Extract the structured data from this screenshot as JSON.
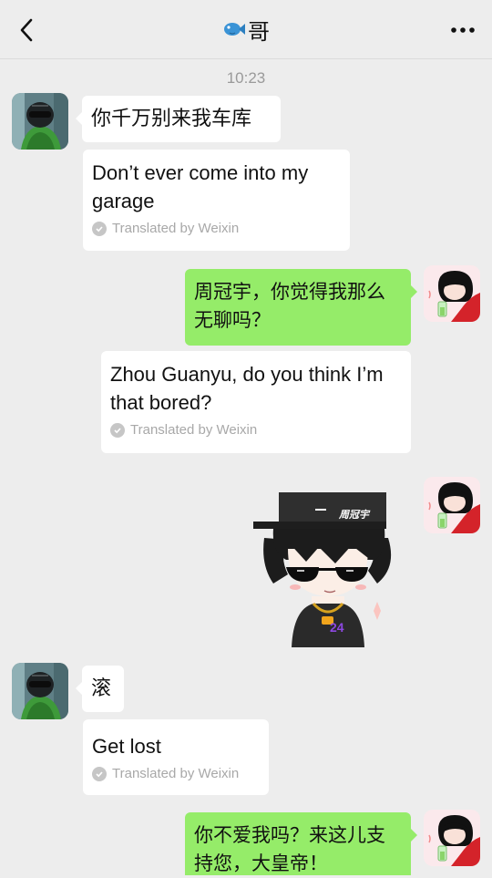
{
  "header": {
    "title_emoji_icon": "fish-icon",
    "title": "哥",
    "back_icon": "chevron-left-icon",
    "more_icon": "ellipsis-icon"
  },
  "timestamp": "10:23",
  "messages": [
    {
      "side": "left",
      "text": "你千万别来我车库",
      "translation": "Don’t ever come into my garage",
      "translated_by": "Translated by Weixin"
    },
    {
      "side": "right",
      "text": "周冠宇，你觉得我那么无聊吗？",
      "translation": "Zhou Guanyu, do you think I’m that bored?",
      "translated_by": "Translated by Weixin"
    },
    {
      "side": "right",
      "type": "sticker",
      "sticker_cap_text": "周冠宇",
      "sticker_number": "24"
    },
    {
      "side": "left",
      "text": "滚",
      "translation": "Get lost",
      "translated_by": "Translated by Weixin"
    },
    {
      "side": "right",
      "text": "你不爱我吗？来这儿支持您，大皇帝！"
    }
  ],
  "colors": {
    "background": "#ededed",
    "bubble_self": "#95ec69",
    "bubble_other": "#ffffff",
    "timestamp": "#9a9a9a"
  }
}
